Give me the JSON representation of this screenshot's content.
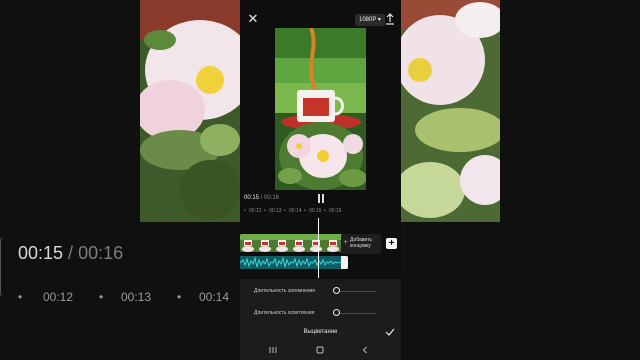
{
  "topbar": {
    "resolution": "1080P ▾"
  },
  "playback": {
    "current_time": "00:15",
    "separator": " / ",
    "total_time": "00:16"
  },
  "ruler": {
    "ticks": [
      "•",
      "00:12",
      "•",
      "00:13",
      "•",
      "00:14",
      "•",
      "00:15",
      "•",
      "00:16"
    ]
  },
  "timeline": {
    "add_ending_line1": "Добавить",
    "add_ending_line2": "концовку",
    "add_ending_plus": "+",
    "add_clip": "+"
  },
  "fade_panel": {
    "fade_in_label": "Длительность затемнения",
    "fade_out_label": "Длительность осветления",
    "title": "Выцветание",
    "fade_in_value": 0,
    "fade_out_value": 0
  },
  "background": {
    "current_time": "00:15",
    "separator": " / ",
    "total_time": "00:16",
    "ticks": [
      "•",
      "00:12",
      "•",
      "00:13",
      "•",
      "00:14"
    ]
  },
  "icons": {
    "close": "close-icon",
    "export": "upload-icon",
    "pause": "pause-icon",
    "confirm": "checkmark-icon",
    "nav_recent": "recent-apps-icon",
    "nav_home": "home-icon",
    "nav_back": "back-icon"
  },
  "colors": {
    "audio_track": "#0f5c62",
    "sheet": "#1c1c1c"
  }
}
